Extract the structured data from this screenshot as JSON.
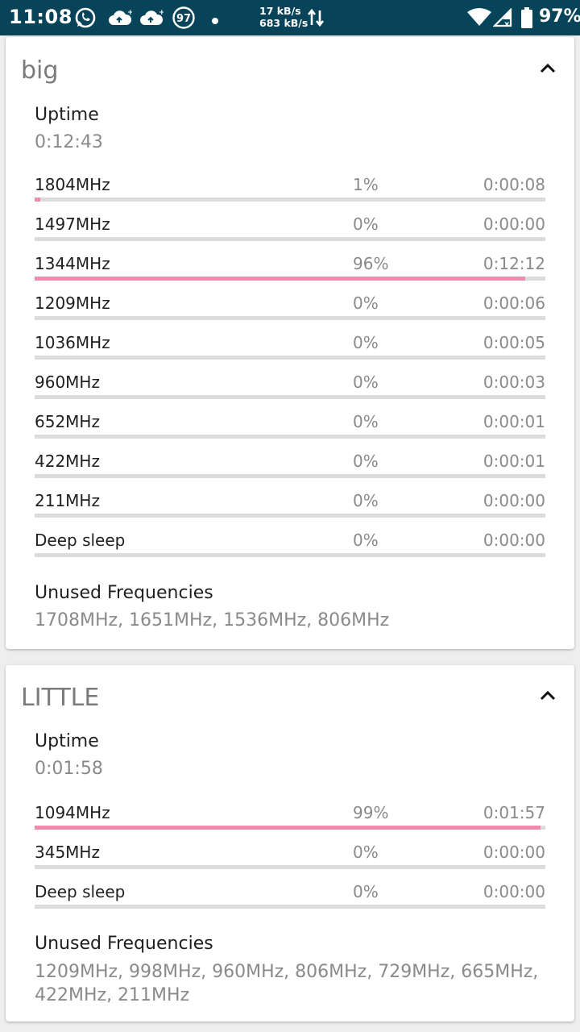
{
  "status_bar": {
    "time": "11:08",
    "notification_badge": "97",
    "net_up": "17 kB/s",
    "net_down": "683 kB/s",
    "battery": "97%",
    "icons": [
      "whatsapp-icon",
      "cloud-upload-icon",
      "cloud-upload-icon",
      "badge-97-icon",
      "dot-icon",
      "data-transfer-icon",
      "wifi-icon",
      "signal-icon",
      "battery-icon"
    ]
  },
  "clusters": [
    {
      "title": "big",
      "uptime_label": "Uptime",
      "uptime_value": "0:12:43",
      "states": [
        {
          "freq": "1804MHz",
          "pct": "1%",
          "time": "0:00:08",
          "fill": 0.01
        },
        {
          "freq": "1497MHz",
          "pct": "0%",
          "time": "0:00:00",
          "fill": 0
        },
        {
          "freq": "1344MHz",
          "pct": "96%",
          "time": "0:12:12",
          "fill": 0.96
        },
        {
          "freq": "1209MHz",
          "pct": "0%",
          "time": "0:00:06",
          "fill": 0
        },
        {
          "freq": "1036MHz",
          "pct": "0%",
          "time": "0:00:05",
          "fill": 0
        },
        {
          "freq": "960MHz",
          "pct": "0%",
          "time": "0:00:03",
          "fill": 0
        },
        {
          "freq": "652MHz",
          "pct": "0%",
          "time": "0:00:01",
          "fill": 0
        },
        {
          "freq": "422MHz",
          "pct": "0%",
          "time": "0:00:01",
          "fill": 0
        },
        {
          "freq": "211MHz",
          "pct": "0%",
          "time": "0:00:00",
          "fill": 0
        },
        {
          "freq": "Deep sleep",
          "pct": "0%",
          "time": "0:00:00",
          "fill": 0
        }
      ],
      "unused_label": "Unused Frequencies",
      "unused_value": "1708MHz, 1651MHz, 1536MHz, 806MHz"
    },
    {
      "title": "LITTLE",
      "uptime_label": "Uptime",
      "uptime_value": "0:01:58",
      "states": [
        {
          "freq": "1094MHz",
          "pct": "99%",
          "time": "0:01:57",
          "fill": 0.99
        },
        {
          "freq": "345MHz",
          "pct": "0%",
          "time": "0:00:00",
          "fill": 0
        },
        {
          "freq": "Deep sleep",
          "pct": "0%",
          "time": "0:00:00",
          "fill": 0
        }
      ],
      "unused_label": "Unused Frequencies",
      "unused_value": "1209MHz, 998MHz, 960MHz, 806MHz, 729MHz, 665MHz, 422MHz, 211MHz"
    }
  ],
  "colors": {
    "status_bar": "#07445a",
    "bar_fill": "#f08bb0",
    "bar_track": "#dcdcdc"
  }
}
